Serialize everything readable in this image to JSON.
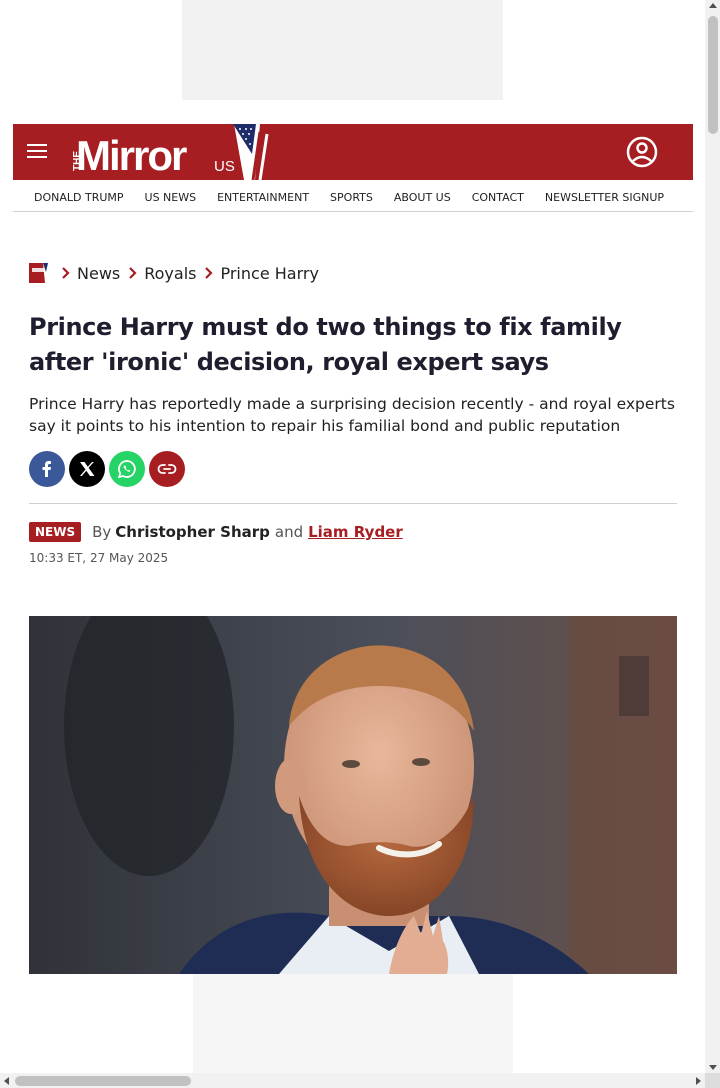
{
  "brand": {
    "name": "The Mirror US",
    "logo_text": "Mirror",
    "logo_prefix": "THE",
    "logo_suffix": "US",
    "accent": "#a61e22"
  },
  "nav": {
    "items": [
      {
        "label": "DONALD TRUMP"
      },
      {
        "label": "US NEWS"
      },
      {
        "label": "ENTERTAINMENT"
      },
      {
        "label": "SPORTS"
      },
      {
        "label": "ABOUT US"
      },
      {
        "label": "CONTACT"
      },
      {
        "label": "NEWSLETTER SIGNUP"
      }
    ]
  },
  "breadcrumb": {
    "items": [
      {
        "label": "News"
      },
      {
        "label": "Royals"
      },
      {
        "label": "Prince Harry"
      }
    ]
  },
  "article": {
    "headline": "Prince Harry must do two things to fix family after 'ironic' decision, royal expert says",
    "standfirst": "Prince Harry has reportedly made a surprising decision recently - and royal experts say it points to his intention to repair his familial bond and public reputation",
    "tag": "NEWS",
    "by": "By",
    "author1": "Christopher Sharp",
    "and": "and",
    "author2": "Liam Ryder",
    "timestamp": "10:33 ET, 27 May 2025"
  },
  "share": {
    "facebook_color": "#3b5998",
    "x_color": "#000000",
    "whatsapp_color": "#25d366",
    "link_color": "#a61e22"
  }
}
